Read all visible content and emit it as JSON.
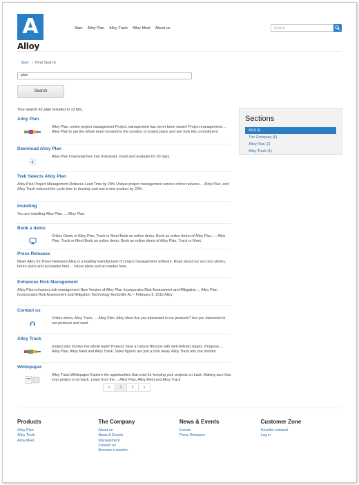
{
  "header": {
    "logo_letter": "A",
    "logo_word": "Alloy",
    "nav": [
      "Start",
      "Alloy Plan",
      "Alloy Track",
      "Alloy Meet",
      "About us"
    ],
    "search_placeholder": "Search"
  },
  "breadcrumb": {
    "home": "Start",
    "separator": "/",
    "current": "Find Search"
  },
  "search": {
    "query": "plan",
    "button_label": "Search"
  },
  "summary": {
    "prefix": "Your search for",
    "term": "plan",
    "suffix": "resulted in 13 hits."
  },
  "results": [
    {
      "title": "Alloy Plan",
      "thumb": "alloy-plan-logo",
      "text": "Alloy Plan, online project management Project management has never been easier! Project management ... Alloy Plan to get the whole team involved in the creation of project plans and see how this commitment"
    },
    {
      "title": "Download Alloy Plan",
      "thumb": "download-icon",
      "text": "Alloy Plan Download free trial Download, install and evaluate for 30 days."
    },
    {
      "title": "Trek Selects Alloy Plan",
      "thumb": "",
      "text": "Alloy Plan Project Management Reduces Lead Time by 20% Unique project management service online reduces ... Alloy Plan, and Alloy Track reduced the cycle time to develop and tool a new product by 20%."
    },
    {
      "title": "Installing",
      "thumb": "",
      "text": "You are installing Alloy Plan. ... Alloy Plan."
    },
    {
      "title": "Book a demo",
      "thumb": "monitor-icon",
      "text": "Online Demo of Alloy Plan, Track or Meet Book an online demo. Book an online demo of Alloy Plan, ... Alloy Plan, Track or Meet Book an online demo. Book an online demo of Alloy Plan, Track or Meet."
    },
    {
      "title": "Press Releases",
      "thumb": "",
      "text": "News Alloy Inc Press Releases Alloy is a leading manufacturer of project management software. Read about our success stories, future plans and accolades here ... future plans and accolades here."
    },
    {
      "title": "Enhances Risk Management",
      "thumb": "",
      "text": "Alloy Plan enhances risk management New Version of Alloy Plan Incorporates Risk Assessment and Mitigation ... Alloy Plan Incorporates Risk Assessment and Mitigation Technology Huntsville AL – February 9, 2012 Alloy"
    },
    {
      "title": "Contact us",
      "thumb": "headset-icon",
      "text": "Online demo, Alloy Track, ... Alloy Plan, Alloy Meet Are you interested in our products? Are you interested in our products and want"
    },
    {
      "title": "Alloy Track",
      "thumb": "alloy-track-logo",
      "text": "project plan Involve the whole team! Projects have a natural lifecycle with well-defined stages. Progress ... Alloy Plan, Alloy Meet and Alloy Track. Sales figures are just a click away. Alloy Track lets you monitor"
    },
    {
      "title": "Whitepaper",
      "thumb": "document-icon",
      "text": "Alloy Track Whitepaper Explore the opportunities that exist for keeping your projects on track. Making sure that your project is on-track. Learn from the ... Alloy Plan, Alloy Meet and Alloy Track"
    }
  ],
  "sidebar": {
    "title": "Sections",
    "items": [
      "All (13)",
      "The Company (6)",
      "Alloy Plan (2)",
      "Alloy Track (1)"
    ]
  },
  "pager": {
    "prev": "«",
    "pages": [
      "1",
      "2"
    ],
    "next": "»"
  },
  "footer": [
    {
      "title": "Products",
      "links": [
        "Alloy Plan",
        "Alloy Track",
        "Alloy Meet"
      ]
    },
    {
      "title": "The Company",
      "links": [
        "About us",
        "News & Events",
        "Management",
        "Contact us",
        "Become a reseller"
      ]
    },
    {
      "title": "News & Events",
      "links": [
        "Events",
        "Press Releases"
      ]
    },
    {
      "title": "Customer Zone",
      "links": [
        "Reseller extranet",
        "Log in"
      ]
    }
  ],
  "colors": {
    "accent": "#2a7fc4",
    "link": "#2a6aa8"
  }
}
